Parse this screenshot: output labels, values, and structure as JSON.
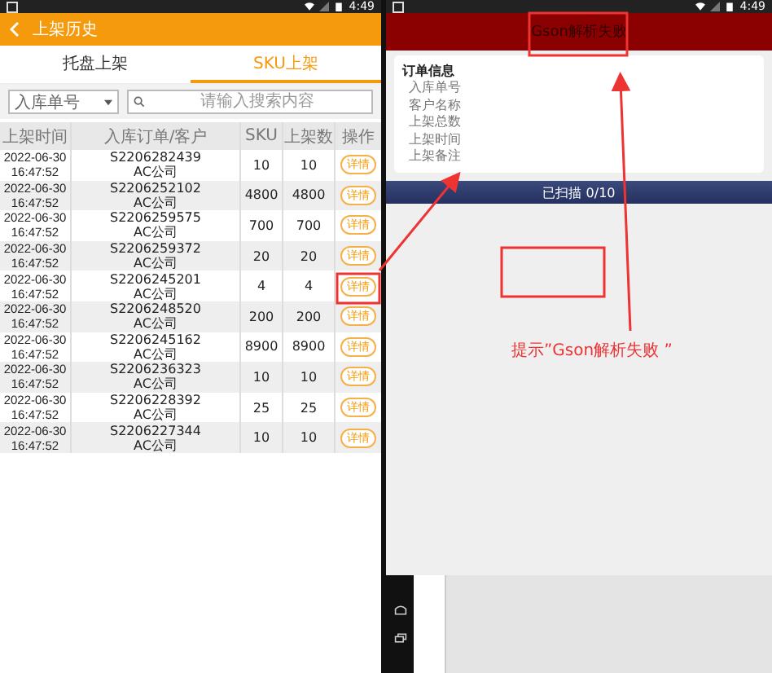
{
  "left": {
    "status_time": "4:49",
    "title": "上架历史",
    "tabs": [
      {
        "label": "托盘上架",
        "selected": false
      },
      {
        "label": "SKU上架",
        "selected": true
      }
    ],
    "filter": {
      "value": "入库单号",
      "placeholder": "请输入搜索内容"
    },
    "columns": [
      "上架时间",
      "入库订单/客户",
      "SKU",
      "上架数",
      "操作"
    ],
    "rows": [
      {
        "date": "2022-06-30",
        "time": "16:47:52",
        "order": "S2206282439",
        "customer": "AC公司",
        "sku": "10",
        "count": "10",
        "action": "详情"
      },
      {
        "date": "2022-06-30",
        "time": "16:47:52",
        "order": "S2206252102",
        "customer": "AC公司",
        "sku": "4800",
        "count": "4800",
        "action": "详情"
      },
      {
        "date": "2022-06-30",
        "time": "16:47:52",
        "order": "S2206259575",
        "customer": "AC公司",
        "sku": "700",
        "count": "700",
        "action": "详情"
      },
      {
        "date": "2022-06-30",
        "time": "16:47:52",
        "order": "S2206259372",
        "customer": "AC公司",
        "sku": "20",
        "count": "20",
        "action": "详情"
      },
      {
        "date": "2022-06-30",
        "time": "16:47:52",
        "order": "S2206245201",
        "customer": "AC公司",
        "sku": "4",
        "count": "4",
        "action": "详情"
      },
      {
        "date": "2022-06-30",
        "time": "16:47:52",
        "order": "S2206248520",
        "customer": "AC公司",
        "sku": "200",
        "count": "200",
        "action": "详情"
      },
      {
        "date": "2022-06-30",
        "time": "16:47:52",
        "order": "S2206245162",
        "customer": "AC公司",
        "sku": "8900",
        "count": "8900",
        "action": "详情"
      },
      {
        "date": "2022-06-30",
        "time": "16:47:52",
        "order": "S2206236323",
        "customer": "AC公司",
        "sku": "10",
        "count": "10",
        "action": "详情"
      },
      {
        "date": "2022-06-30",
        "time": "16:47:52",
        "order": "S2206228392",
        "customer": "AC公司",
        "sku": "25",
        "count": "25",
        "action": "详情"
      },
      {
        "date": "2022-06-30",
        "time": "16:47:52",
        "order": "S2206227344",
        "customer": "AC公司",
        "sku": "10",
        "count": "10",
        "action": "详情"
      }
    ]
  },
  "right": {
    "status_time": "4:49",
    "title": "Gson解析失败",
    "card": {
      "title": "订单信息",
      "fields": [
        "入库单号",
        "客户名称",
        "上架总数",
        "上架时间",
        "上架备注"
      ]
    },
    "scan_bar": "已扫描 0/10"
  },
  "annotation": {
    "text": "提示”Gson解析失败 ”"
  }
}
